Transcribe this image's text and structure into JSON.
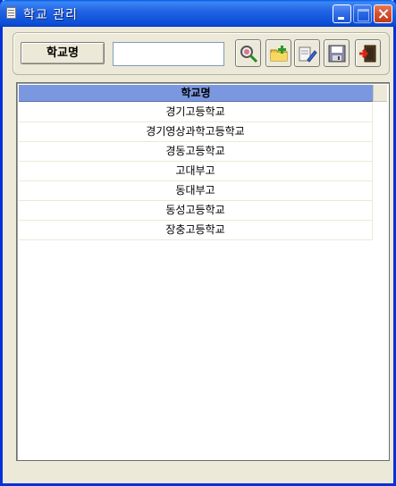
{
  "window": {
    "title": "학교 관리"
  },
  "toolbar": {
    "field_label": "학교명",
    "search_value": "",
    "buttons": [
      {
        "name": "search",
        "icon": "search-icon"
      },
      {
        "name": "open",
        "icon": "folder-add-icon"
      },
      {
        "name": "edit",
        "icon": "edit-icon"
      },
      {
        "name": "save",
        "icon": "save-icon"
      },
      {
        "name": "exit",
        "icon": "exit-door-icon"
      }
    ]
  },
  "grid": {
    "column_header": "학교명",
    "rows": [
      "경기고등학교",
      "경기영상과학고등학교",
      "경동고등학교",
      "고대부고",
      "동대부고",
      "동성고등학교",
      "장충고등학교"
    ]
  },
  "colors": {
    "title_bar": "#2464e4",
    "header_bg": "#7b97e0",
    "window_bg": "#ece9d8",
    "close_button": "#d5502e"
  }
}
